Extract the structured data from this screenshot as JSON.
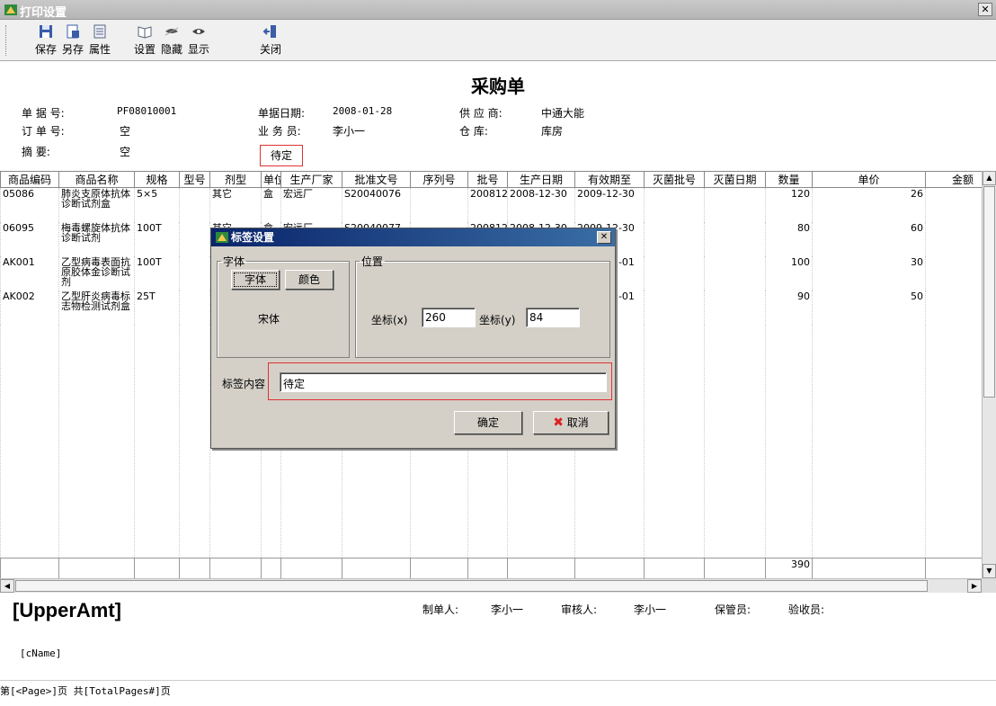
{
  "window": {
    "title": "打印设置",
    "close_glyph": "✕"
  },
  "toolbar": {
    "save": "保存",
    "save_as": "另存",
    "properties": "属性",
    "settings": "设置",
    "hide": "隐藏",
    "show": "显示",
    "close": "关闭"
  },
  "document": {
    "title": "采购单",
    "fields": {
      "doc_no_label": "单 据 号:",
      "doc_no": "PF08010001",
      "doc_date_label": "单据日期:",
      "doc_date": "2008-01-28",
      "supplier_label": "供 应 商:",
      "supplier": "中通大能",
      "order_no_label": "订 单 号:",
      "order_no": "空",
      "salesman_label": "业 务 员:",
      "salesman": "李小一",
      "warehouse_label": "仓    库:",
      "warehouse": "库房",
      "summary_label": "摘    要:",
      "summary": "空"
    },
    "stamp": "待定"
  },
  "grid": {
    "columns": [
      "商品编码",
      "商品名称",
      "规格",
      "型号",
      "剂型",
      "单位",
      "生产厂家",
      "批准文号",
      "序列号",
      "批号",
      "生产日期",
      "有效期至",
      "灭菌批号",
      "灭菌日期",
      "数量",
      "单价",
      "金额"
    ],
    "rows": [
      [
        "05086",
        "肺炎支原体抗体诊断试剂盒",
        "5×5",
        "",
        "其它",
        "盒",
        "宏远厂",
        "S20040076",
        "",
        "200812",
        "2008-12-30",
        "2009-12-30",
        "",
        "",
        "120",
        "26",
        ""
      ],
      [
        "06095",
        "梅毒螺旋体抗体诊断试剂",
        "100T",
        "",
        "其它",
        "盒",
        "宏远厂",
        "S20040077",
        "",
        "200812",
        "2008-12-30",
        "2009-12-30",
        "",
        "",
        "80",
        "60",
        ""
      ],
      [
        "AK001",
        "乙型病毒表面抗原胶体金诊断试剂",
        "100T",
        "",
        "",
        "",
        "",
        "",
        "",
        "",
        "",
        "2010-01-01",
        "",
        "",
        "100",
        "30",
        ""
      ],
      [
        "AK002",
        "乙型肝炎病毒标志物检测试剂盒",
        "25T",
        "",
        "",
        "",
        "",
        "",
        "",
        "",
        "",
        "2010-01-01",
        "",
        "",
        "90",
        "50",
        ""
      ]
    ],
    "total_quantity": "390"
  },
  "footer": {
    "upper_amt": "[UpperAmt]",
    "maker_label": "制单人:",
    "maker": "李小一",
    "auditor_label": "审核人:",
    "auditor": "李小一",
    "keeper_label": "保管员:",
    "inspector_label": "验收员:",
    "cname": "[cName]",
    "page_line": "第[<Page>]页 共[TotalPages#]页"
  },
  "dialog": {
    "title": "标签设置",
    "close_glyph": "✕",
    "font_group": "字体",
    "font_button": "字体",
    "color_button": "颜色",
    "font_name": "宋体",
    "position_group": "位置",
    "x_label": "坐标(x)",
    "x_value": "260",
    "y_label": "坐标(y)",
    "y_value": "84",
    "content_label": "标签内容",
    "content_value": "待定",
    "ok": "确定",
    "cancel": "取消"
  },
  "colors": {
    "title_bar": "#0a246a",
    "highlight": "#e03030",
    "dialog_bg": "#d4d0c8"
  }
}
